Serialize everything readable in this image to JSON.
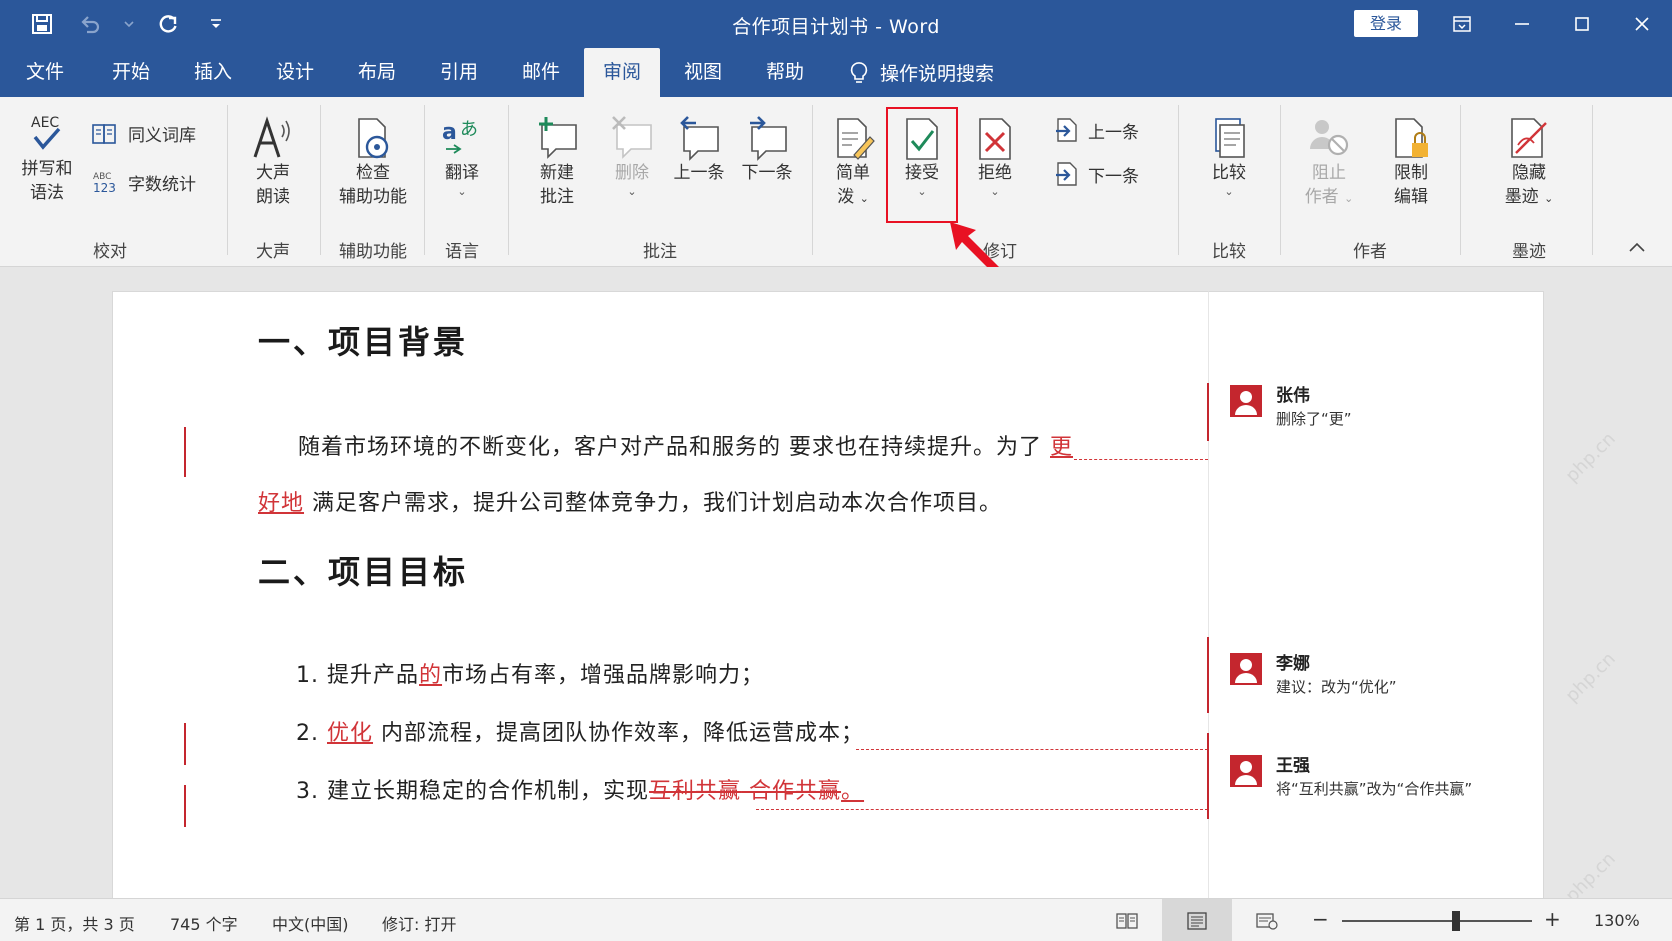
{
  "app": {
    "title": "合作项目计划书  -  Word",
    "login_label": "登录"
  },
  "tabs": [
    {
      "label": "文件"
    },
    {
      "label": "开始"
    },
    {
      "label": "插入"
    },
    {
      "label": "设计"
    },
    {
      "label": "布局"
    },
    {
      "label": "引用"
    },
    {
      "label": "邮件"
    },
    {
      "label": "审阅"
    },
    {
      "label": "视图"
    },
    {
      "label": "帮助"
    }
  ],
  "active_tab": "审阅",
  "tell_me": "操作说明搜索",
  "ribbon": {
    "proofing": {
      "spelling_l1": "拼写和",
      "spelling_l2": "语法",
      "thesaurus": "同义词库",
      "wordcount": "字数统计",
      "aec_text": "AEC",
      "abc_text": "ABC",
      "num_text": "123",
      "label": "校对"
    },
    "speech": {
      "read_l1": "大声",
      "read_l2": "朗读",
      "label": "大声"
    },
    "accessibility": {
      "check_l1": "检查",
      "check_l2": "辅助功能",
      "label": "辅助功能"
    },
    "language": {
      "translate": "翻译",
      "label": "语言"
    },
    "comments": {
      "new_l1": "新建",
      "new_l2": "批注",
      "delete": "删除",
      "prev": "上一条",
      "next": "下一条",
      "label": "批注"
    },
    "tracking": {
      "markup_l1": "简单",
      "markup_l2": "泼",
      "accept": "接受",
      "reject": "拒绝",
      "prev": "上一条",
      "next": "下一条",
      "label": "修订"
    },
    "compare": {
      "compare": "比较",
      "label": "比较"
    },
    "protect": {
      "block_l1": "阻止",
      "block_l2": "作者",
      "restrict_l1": "限制",
      "restrict_l2": "编辑",
      "label": "作者"
    },
    "ink": {
      "hide_l1": "隐藏",
      "hide_l2": "墨迹",
      "label": "墨迹"
    }
  },
  "document": {
    "heading1": "一、项目背景",
    "p1_a": "随着市场环境的不断变化，客户对产品和服务的 要求也在持续提升。为了",
    "p1_ins1": "更",
    "p1_ins2": "好地",
    "p1_b": "满足客户需求，提升公司整体竞争力，我们计划启动本次合作项目。",
    "heading2": "二、项目目标",
    "li1_num": "1.",
    "li1_a": "提升产品",
    "li1_ins": "的",
    "li1_b": "市场占有率，增强品牌影响力；",
    "li2_num": "2.",
    "li2_ins": "优化",
    "li2_b": "内部流程，提高团队协作效率，降低运营成本；",
    "li3_num": "3.",
    "li3_a": "建立长期稳定的合作机制，实现",
    "li3_del": "互利共赢",
    "li3_ins": " 合作共赢",
    "li3_b": "。"
  },
  "comments": [
    {
      "author": "张伟",
      "text": "删除了“更”"
    },
    {
      "author": "李娜",
      "text": "建议：改为“优化”"
    },
    {
      "author": "王强",
      "text": "将“互利共赢”改为“合作共赢”"
    }
  ],
  "watermark": "php.cn",
  "statusbar": {
    "page": "第 1 页，共 3 页",
    "words": "745 个字",
    "language": "中文(中国)",
    "track": "修订: 打开",
    "zoom_minus": "−",
    "zoom_plus": "+",
    "zoom": "130%",
    "zoom_level": 0.6
  },
  "colors": {
    "brand": "#2b579a",
    "revision": "#d13438",
    "highlight": "#e81123"
  }
}
